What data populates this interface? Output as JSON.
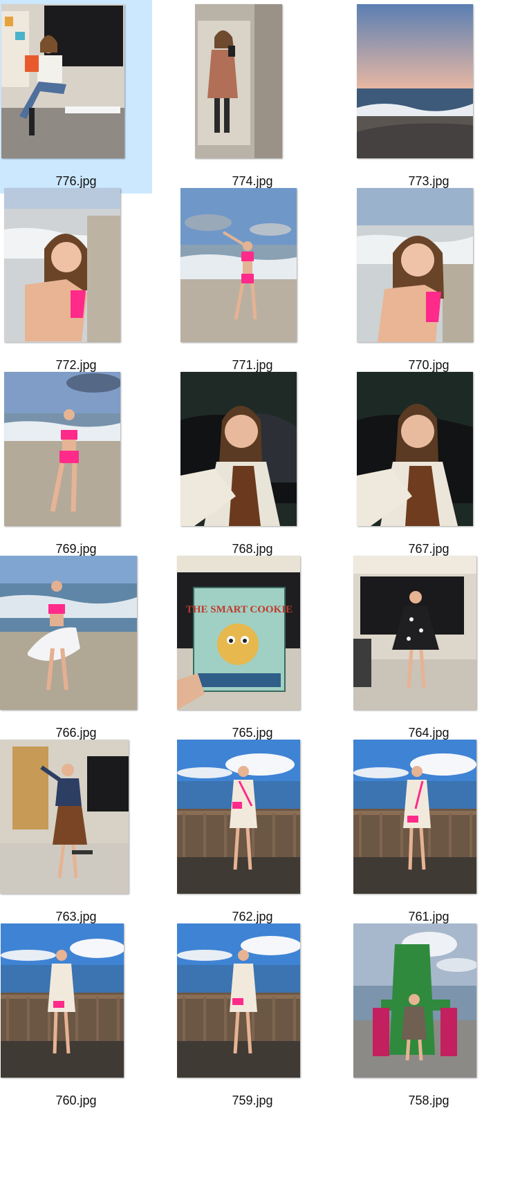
{
  "files": [
    {
      "name": "776.jpg",
      "scene": "classroom",
      "selected": true
    },
    {
      "name": "774.jpg",
      "scene": "mirror-selfie"
    },
    {
      "name": "773.jpg",
      "scene": "beach-dusk"
    },
    {
      "name": "772.jpg",
      "scene": "beach-selfie"
    },
    {
      "name": "771.jpg",
      "scene": "beach-full"
    },
    {
      "name": "770.jpg",
      "scene": "beach-selfie"
    },
    {
      "name": "769.jpg",
      "scene": "beach-full"
    },
    {
      "name": "768.jpg",
      "scene": "car-selfie"
    },
    {
      "name": "767.jpg",
      "scene": "car-selfie"
    },
    {
      "name": "766.jpg",
      "scene": "beach-wrap"
    },
    {
      "name": "765.jpg",
      "scene": "book",
      "book_title": "THE SMART COOKIE"
    },
    {
      "name": "764.jpg",
      "scene": "classroom-dress"
    },
    {
      "name": "763.jpg",
      "scene": "classroom-jacket"
    },
    {
      "name": "762.jpg",
      "scene": "pier"
    },
    {
      "name": "761.jpg",
      "scene": "pier"
    },
    {
      "name": "760.jpg",
      "scene": "pier"
    },
    {
      "name": "759.jpg",
      "scene": "pier"
    },
    {
      "name": "758.jpg",
      "scene": "chair"
    }
  ],
  "colors": {
    "selection": "#cce8ff",
    "bikini": "#ff2a8a",
    "sky": "#5d95d6",
    "sea": "#3f78b8",
    "sand": "#c9bfae"
  }
}
